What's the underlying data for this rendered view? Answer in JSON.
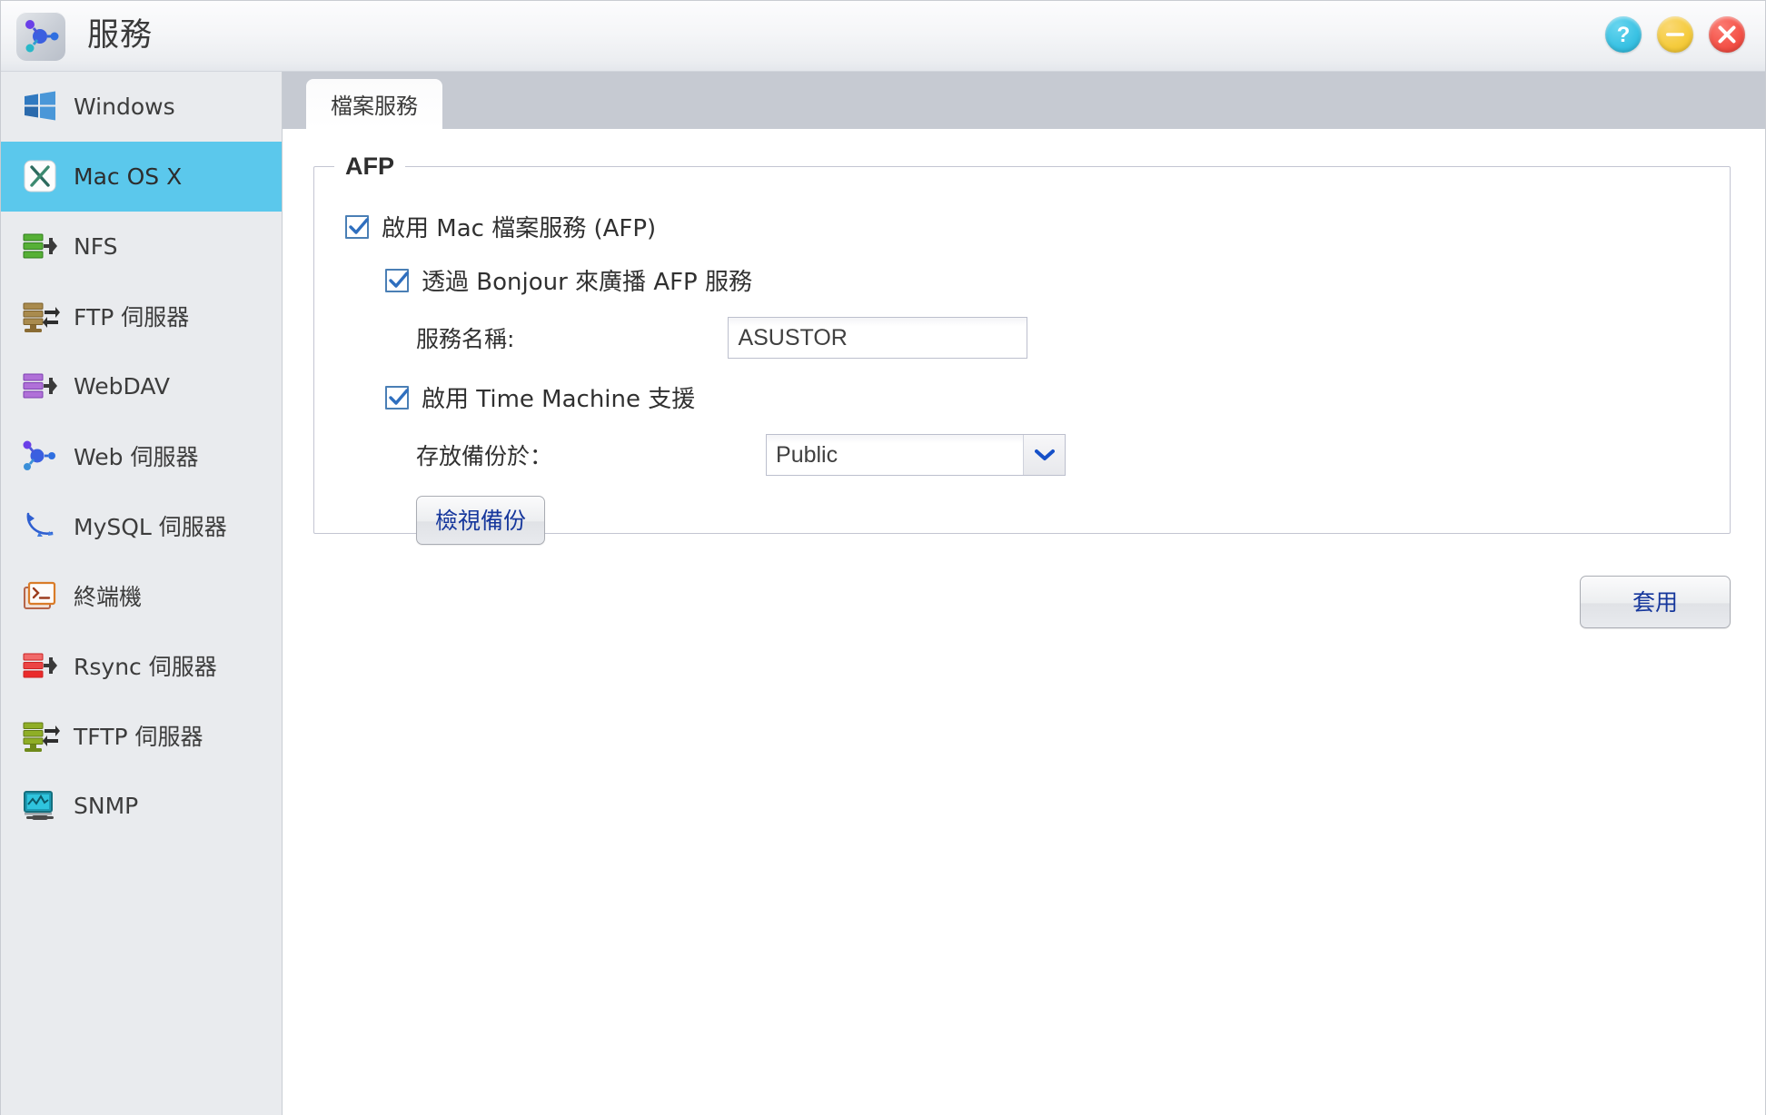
{
  "window": {
    "title": "服務",
    "app_icon": "services-network-icon",
    "controls": [
      {
        "name": "help-button",
        "glyph": "?",
        "color": "#3cc3e4"
      },
      {
        "name": "minimize-button",
        "glyph": "–",
        "color": "#f5cc3f"
      },
      {
        "name": "close-button",
        "glyph": "✕",
        "color": "#f4544a"
      }
    ]
  },
  "sidebar": {
    "items": [
      {
        "label": "Windows",
        "icon": "windows-logo-icon",
        "color": "#2f7ec4",
        "selected": false
      },
      {
        "label": "Mac OS X",
        "icon": "mac-osx-icon",
        "color": "#2e6b5e",
        "selected": true
      },
      {
        "label": "NFS",
        "icon": "nfs-server-icon",
        "color": "#56b036",
        "selected": false
      },
      {
        "label": "FTP 伺服器",
        "icon": "ftp-server-icon",
        "color": "#9b7d3c",
        "selected": false
      },
      {
        "label": "WebDAV",
        "icon": "webdav-server-icon",
        "color": "#a濃",
        "selected": false
      },
      {
        "label": "Web 伺服器",
        "icon": "web-server-icon",
        "color": "#4a52e0",
        "selected": false
      },
      {
        "label": "MySQL 伺服器",
        "icon": "mysql-dolphin-icon",
        "color": "#2f5fd0",
        "selected": false
      },
      {
        "label": "終端機",
        "icon": "terminal-icon",
        "color": "#c86a3c",
        "selected": false
      },
      {
        "label": "Rsync 伺服器",
        "icon": "rsync-server-icon",
        "color": "#ea3b3b",
        "selected": false
      },
      {
        "label": "TFTP 伺服器",
        "icon": "tftp-server-icon",
        "color": "#82a020",
        "selected": false
      },
      {
        "label": "SNMP",
        "icon": "snmp-monitor-icon",
        "color": "#1e9bb4",
        "selected": false
      }
    ]
  },
  "tabs": [
    {
      "label": "檔案服務",
      "active": true
    }
  ],
  "afp": {
    "legend": "AFP",
    "enable_afp": {
      "label": "啟用 Mac 檔案服務 (AFP)",
      "checked": true
    },
    "bonjour": {
      "label": "透過 Bonjour 來廣播 AFP 服務",
      "checked": true
    },
    "service_name": {
      "label": "服務名稱:",
      "value": "ASUSTOR",
      "placeholder": "ASUSTOR"
    },
    "time_machine": {
      "label": "啟用 Time Machine 支援",
      "checked": true
    },
    "backup_folder": {
      "label": "存放備份於：",
      "value": "Public",
      "options": [
        "Public"
      ]
    },
    "view_backups_button": "檢視備份"
  },
  "footer": {
    "apply_button": "套用"
  },
  "theme": {
    "selection": "#5bc8ec",
    "tabstrip": "#c6cad2",
    "sidebar_bg": "#e9ebee",
    "checkbox_blue": "#4a7fb5",
    "button_text": "#16379c"
  }
}
